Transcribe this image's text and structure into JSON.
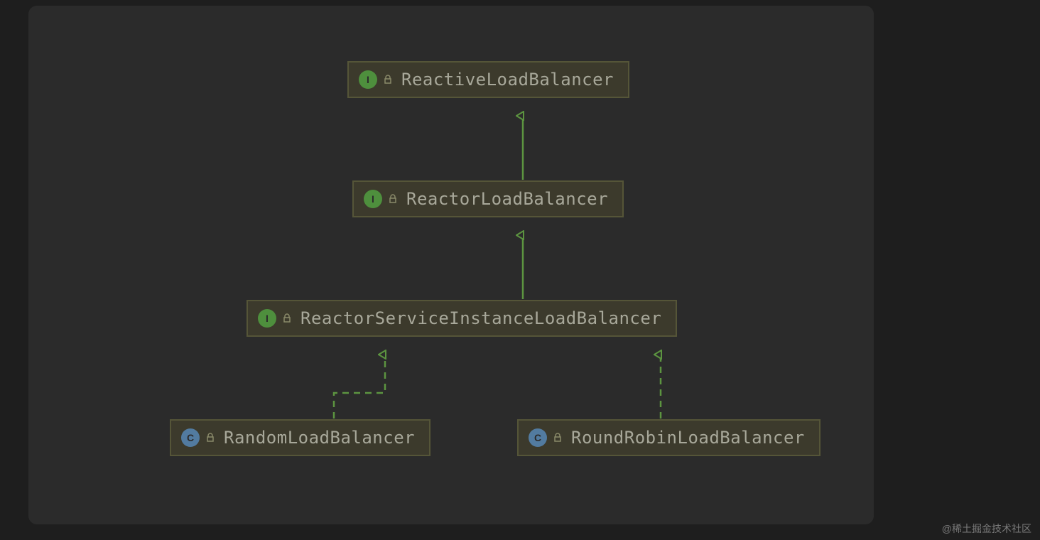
{
  "nodes": {
    "n1": {
      "kind": "interface",
      "label": "ReactiveLoadBalancer"
    },
    "n2": {
      "kind": "interface",
      "label": "ReactorLoadBalancer"
    },
    "n3": {
      "kind": "interface",
      "label": "ReactorServiceInstanceLoadBalancer"
    },
    "n4": {
      "kind": "class",
      "label": "RandomLoadBalancer"
    },
    "n5": {
      "kind": "class",
      "label": "RoundRobinLoadBalancer"
    }
  },
  "edges": [
    {
      "from": "n2",
      "to": "n1",
      "style": "solid"
    },
    {
      "from": "n3",
      "to": "n2",
      "style": "solid"
    },
    {
      "from": "n4",
      "to": "n3",
      "style": "dashed"
    },
    {
      "from": "n5",
      "to": "n3",
      "style": "dashed"
    }
  ],
  "colors": {
    "arrow": "#5c9440",
    "interface_icon": "#4e8f3d",
    "class_icon": "#527ba0",
    "node_border": "#555538",
    "node_bg": "#3c3a2c"
  },
  "watermark": "@稀土掘金技术社区"
}
